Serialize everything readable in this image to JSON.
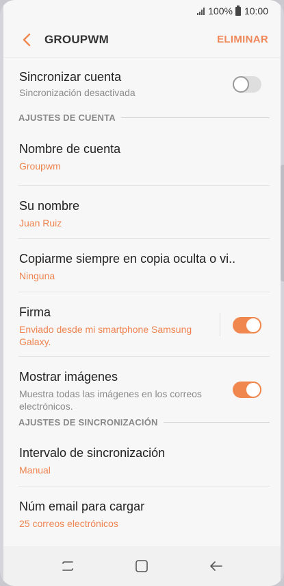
{
  "status_bar": {
    "battery_percent": "100%",
    "time": "10:00"
  },
  "header": {
    "back_icon": "chevron-left-icon",
    "title": "GROUPWM",
    "delete_label": "ELIMINAR"
  },
  "sync_account": {
    "label": "Sincronizar cuenta",
    "status": "Sincronización desactivada",
    "enabled": false
  },
  "sections": {
    "account_settings": "AJUSTES DE CUENTA",
    "sync_settings": "AJUSTES DE SINCRONIZACIÓN"
  },
  "account": {
    "name_label": "Nombre de cuenta",
    "name_value": "Groupwm",
    "your_name_label": "Su nombre",
    "your_name_value": "Juan Ruiz",
    "bcc_label": "Copiarme siempre en copia oculta o vi..",
    "bcc_value": "Ninguna",
    "signature_label": "Firma",
    "signature_value": "Enviado desde mi smartphone Samsung Galaxy.",
    "signature_enabled": true,
    "show_images_label": "Mostrar imágenes",
    "show_images_desc": "Muestra todas las imágenes en los correos electrónicos.",
    "show_images_enabled": true
  },
  "sync": {
    "interval_label": "Intervalo de sincronización",
    "interval_value": "Manual",
    "email_count_label": "Núm email para cargar",
    "email_count_value": "25 correos electrónicos"
  },
  "navbar": {
    "recents_icon": "recent-apps-icon",
    "home_icon": "home-icon",
    "back_icon": "back-arrow-icon"
  },
  "colors": {
    "accent": "#f0874e",
    "background": "#f7f7f7"
  }
}
